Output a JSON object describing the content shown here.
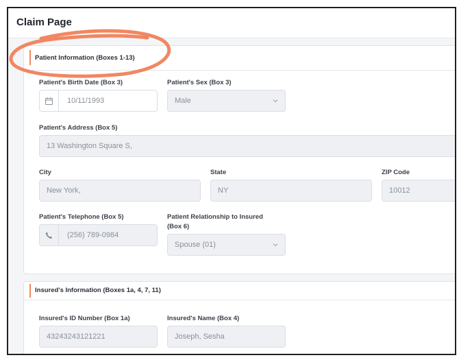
{
  "page": {
    "title": "Claim Page"
  },
  "patient_section": {
    "title": "Patient Information (Boxes 1-13)",
    "birth_date": {
      "label": "Patient's Birth Date (Box 3)",
      "value": "10/11/1993",
      "icon": "calendar-icon"
    },
    "sex": {
      "label": "Patient's Sex (Box 3)",
      "value": "Male"
    },
    "address": {
      "label": "Patient's Address (Box 5)",
      "value": "13 Washington Square S,"
    },
    "city": {
      "label": "City",
      "value": "New York,"
    },
    "state": {
      "label": "State",
      "value": "NY"
    },
    "zip": {
      "label": "ZIP Code",
      "value": "10012"
    },
    "telephone": {
      "label": "Patient's Telephone (Box 5)",
      "value": "(256) 789-0984",
      "icon": "phone-icon"
    },
    "relationship": {
      "label_line1": "Patient Relationship to Insured",
      "label_line2": "(Box 6)",
      "value": "Spouse (01)"
    }
  },
  "insured_section": {
    "title": "Insured's Information (Boxes 1a, 4, 7, 11)",
    "id_number": {
      "label": "Insured's ID Number (Box 1a)",
      "value": "43243243121221"
    },
    "name": {
      "label": "Insured's Name (Box 4)",
      "value": "Joseph, Sesha"
    }
  },
  "colors": {
    "accent": "#f08a5d",
    "annotation": "#f07d55",
    "field_bg": "#eef0f3"
  }
}
